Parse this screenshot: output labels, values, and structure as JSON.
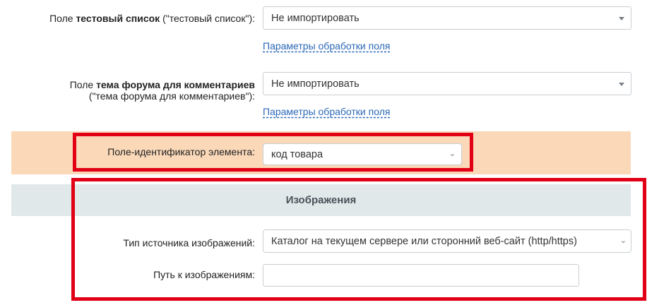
{
  "fields": {
    "test_list": {
      "label_prefix": "Поле ",
      "label_bold": "тестовый список",
      "label_suffix": " (\"тестовый список\"):",
      "select_value": "Не импортировать",
      "link": "Параметры обработки поля"
    },
    "forum_topic": {
      "label_prefix": "Поле ",
      "label_bold": "тема форума для комментариев",
      "label_line2": "(\"тема форума для комментариев\"):",
      "select_value": "Не импортировать",
      "link": "Параметры обработки поля"
    },
    "element_id": {
      "label": "Поле-идентификатор элемента:",
      "select_value": "код товара"
    }
  },
  "images_section": {
    "title": "Изображения",
    "source_type": {
      "label": "Тип источника изображений:",
      "select_value": "Каталог на текущем сервере или сторонний веб-сайт (http/https)"
    },
    "path": {
      "label": "Путь к изображениям:",
      "value": ""
    }
  },
  "colors": {
    "highlight_border": "#e10015",
    "orange_band": "#fad8b8",
    "section_band": "#e0e8ea",
    "link": "#2a67b7"
  }
}
